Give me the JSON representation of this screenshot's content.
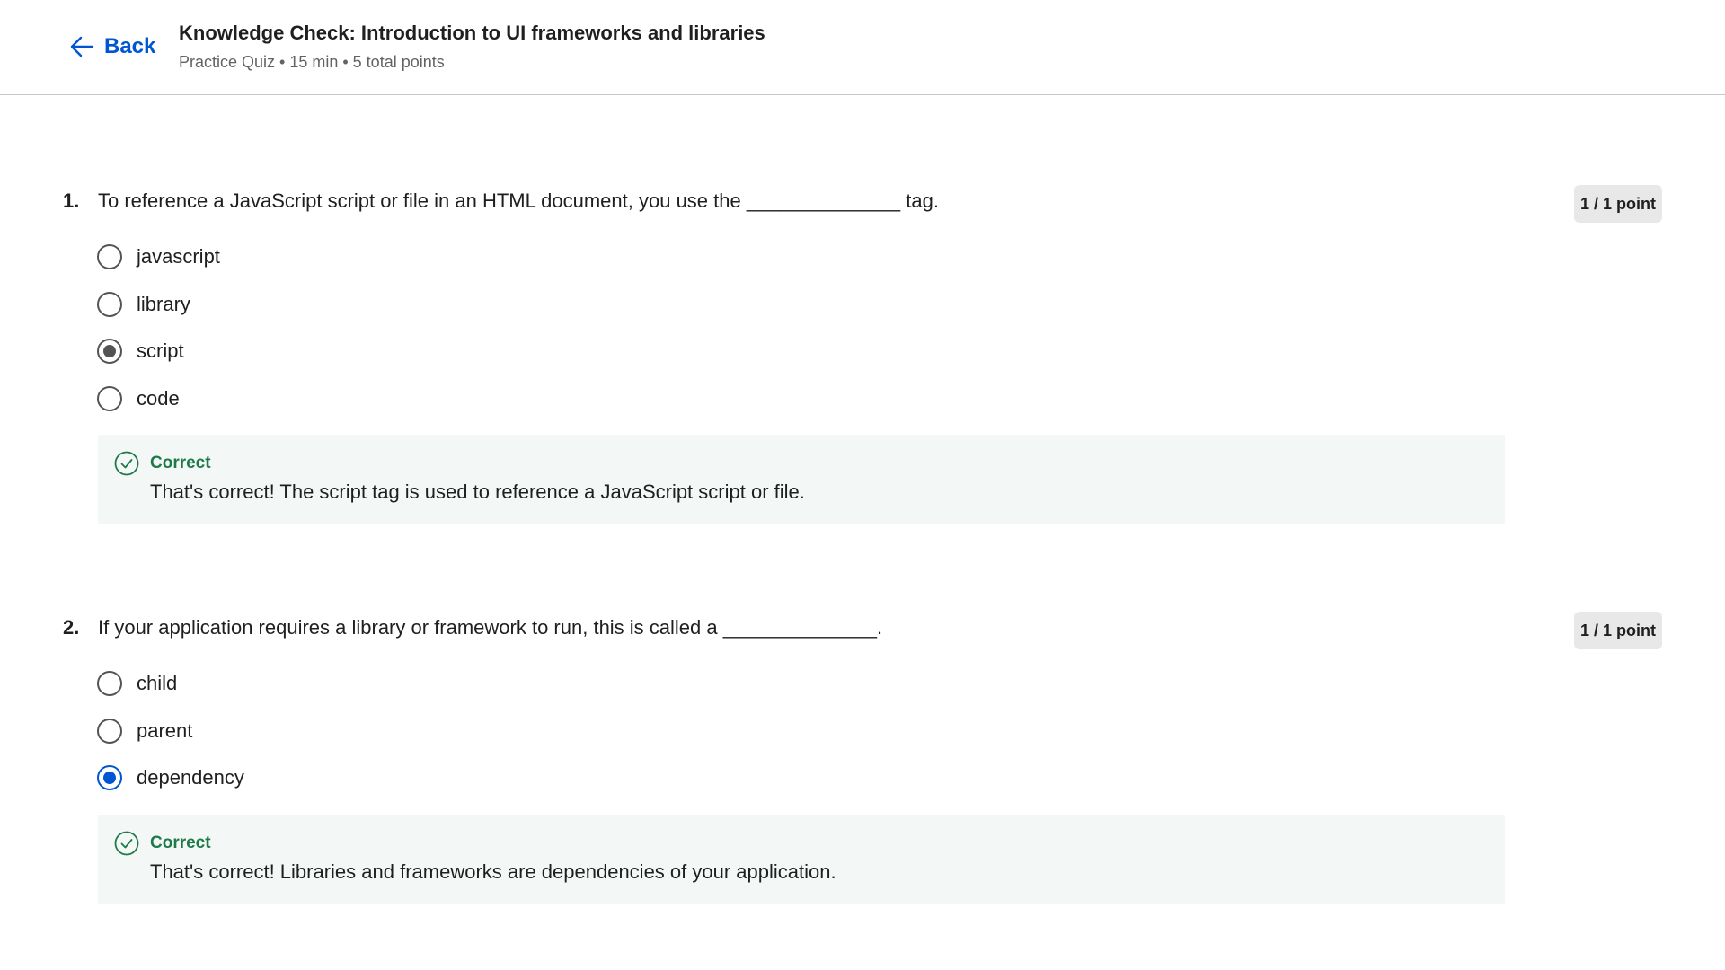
{
  "header": {
    "back_label": "Back",
    "title": "Knowledge Check: Introduction to UI frameworks and libraries",
    "meta": "Practice Quiz • 15 min • 5 total points"
  },
  "questions": [
    {
      "number": "1.",
      "text": "To reference a JavaScript script or file in an HTML document, you use the ______________ tag.",
      "points": "1 / 1 point",
      "options": [
        "javascript",
        "library",
        "script",
        "code"
      ],
      "selected": "script",
      "feedback": {
        "title": "Correct",
        "text": "That's correct! The script tag is used to reference a JavaScript script or file."
      }
    },
    {
      "number": "2.",
      "text": "If your application requires a library or framework to run, this is called a ______________.",
      "points": "1 / 1 point",
      "options": [
        "child",
        "parent",
        "dependency"
      ],
      "selected": "dependency",
      "feedback": {
        "title": "Correct",
        "text": "That's correct! Libraries and frameworks are dependencies of your application."
      }
    }
  ],
  "colors": {
    "link": "#0056d2",
    "correct": "#1f7a4a",
    "feedback_bg": "#f3f8f6",
    "badge_bg": "#e8e8e8"
  },
  "icons": {
    "back": "arrow-left-icon",
    "feedback": "check-circle-icon"
  }
}
